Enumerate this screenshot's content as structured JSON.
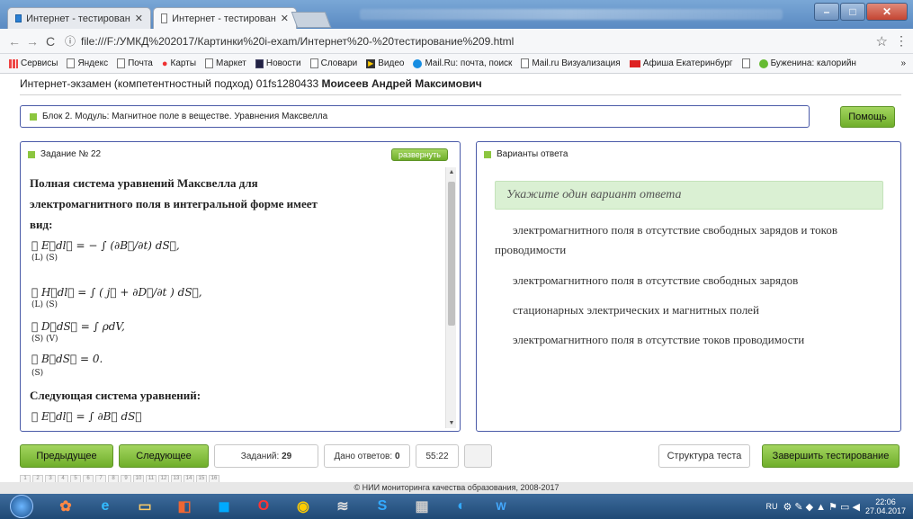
{
  "browser": {
    "tabs": [
      {
        "label": "Интернет - тестирован"
      },
      {
        "label": "Интернет - тестирован"
      }
    ],
    "url": "file:///F:/УМКД%202017/Картинки%20i-exam/Интернет%20-%20тестирование%209.html",
    "bookmarks": [
      {
        "label": "Сервисы"
      },
      {
        "label": "Яндекс"
      },
      {
        "label": "Почта"
      },
      {
        "label": "Карты"
      },
      {
        "label": "Маркет"
      },
      {
        "label": "Новости"
      },
      {
        "label": "Словари"
      },
      {
        "label": "Видео"
      },
      {
        "label": "Mail.Ru: почта, поиск"
      },
      {
        "label": "Mail.ru Визуализация"
      },
      {
        "label": "Афиша Екатеринбург"
      },
      {
        "label": "Буженина: калорийн"
      }
    ],
    "more_bookmarks": "»"
  },
  "page": {
    "exam_title": "Интернет-экзамен (компетентностный подход) 01fs1280433",
    "student_name": "Моисеев Андрей Максимович",
    "block_label": "Блок 2. Модуль: Магнитное поле в веществе. Уравнения Максвелла",
    "help_label": "Помощь"
  },
  "task": {
    "title": "Задание № 22",
    "expand_label": "развернуть",
    "question_line1": "Полная система уравнений Максвелла для",
    "question_line2": "электромагнитного поля в интегральной форме имеет",
    "question_line3": "вид:",
    "eq1": "∮ E⃗dl⃗ = − ∫ (∂B⃗/∂t) dS⃗,",
    "eq1_sub": "(L)           (S)",
    "eq2": "∮ H⃗dl⃗ = ∫ ( j⃗ + ∂D⃗/∂t ) dS⃗,",
    "eq2_sub": "(L)           (S)",
    "eq3": "∮ D⃗dS⃗ = ∫ ρdV,",
    "eq3_sub": "(S)           (V)",
    "eq4": "∮ B⃗dS⃗ = 0.",
    "eq4_sub": "(S)",
    "question_line4": "Следующая система уравнений:",
    "eq5_partial": "∮ E⃗dl⃗ = ∫ ∂B⃗ dS⃗"
  },
  "answers": {
    "title": "Варианты ответа",
    "hint": "Укажите один вариант ответа",
    "options": [
      {
        "line1": "электромагнитного поля в отсутствие свободных зарядов и токов",
        "line2": "проводимости"
      },
      {
        "line1": "электромагнитного поля в отсутствие свободных зарядов"
      },
      {
        "line1": "стационарных электрических и магнитных полей"
      },
      {
        "line1": "электромагнитного поля в отсутствие токов проводимости"
      }
    ]
  },
  "controls": {
    "prev": "Предыдущее",
    "next": "Следующее",
    "tasks_label": "Заданий:",
    "tasks_count": "29",
    "answered_label": "Дано ответов:",
    "answered_count": "0",
    "timer": "55:22",
    "structure": "Структура теста",
    "finish": "Завершить тестирование"
  },
  "pagination": [
    "1",
    "2",
    "3",
    "4",
    "5",
    "6",
    "7",
    "8",
    "9",
    "10",
    "11",
    "12",
    "13",
    "14",
    "15",
    "16"
  ],
  "footer": "© НИИ мониторинга качества образования, 2008-2017",
  "taskbar": {
    "lang": "RU",
    "time": "22:06",
    "date": "27.04.2017"
  },
  "colors": {
    "accent_green": "#8cc63f",
    "panel_border": "#4a5aa8",
    "hint_bg": "#daf0d3"
  }
}
